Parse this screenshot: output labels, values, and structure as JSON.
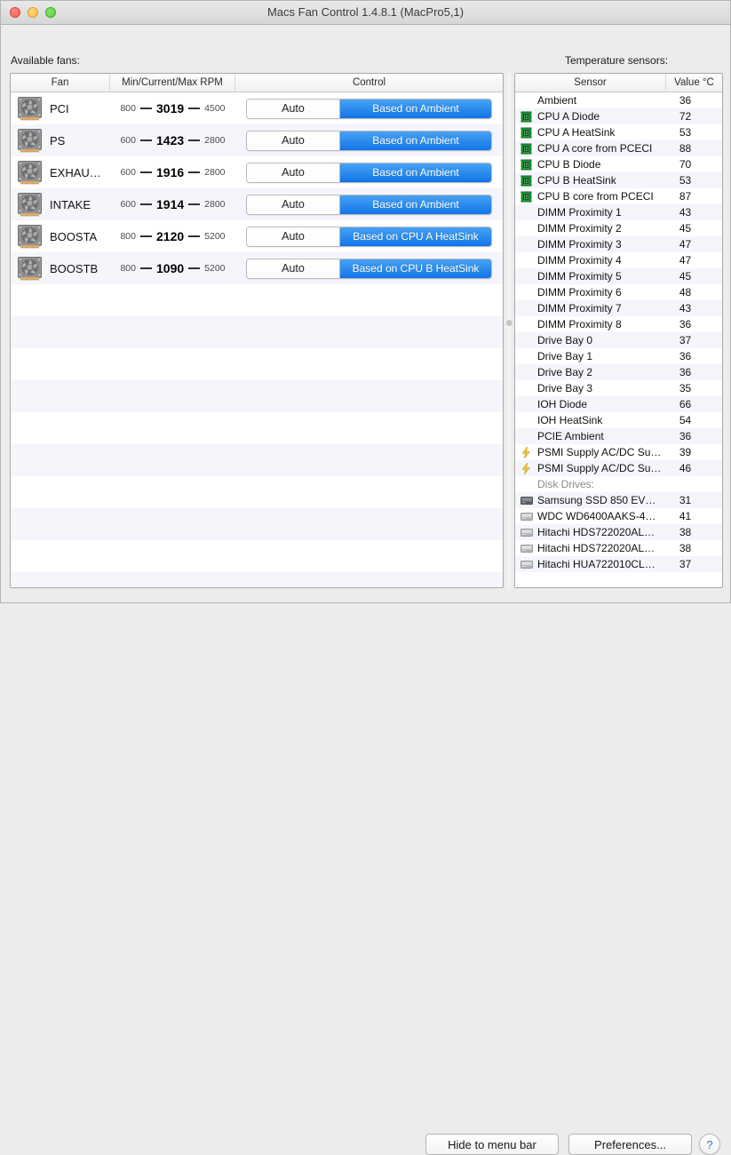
{
  "window": {
    "title": "Macs Fan Control 1.4.8.1 (MacPro5,1)",
    "traffic_lights": [
      "close-button",
      "minimize-button",
      "maximize-button"
    ],
    "accent_blue": "#1175e8",
    "alt_row_color": "#f4f6fb"
  },
  "fans_section": {
    "label": "Available fans:",
    "columns": [
      "Fan",
      "Min/Current/Max RPM",
      "Control"
    ],
    "auto_label": "Auto",
    "rows": [
      {
        "icon": "fan-icon",
        "name": "PCI",
        "min": "800",
        "current": "3019",
        "max": "4500",
        "control": "Based on Ambient"
      },
      {
        "icon": "fan-icon",
        "name": "PS",
        "min": "600",
        "current": "1423",
        "max": "2800",
        "control": "Based on Ambient"
      },
      {
        "icon": "fan-icon",
        "name": "EXHAU…",
        "min": "600",
        "current": "1916",
        "max": "2800",
        "control": "Based on Ambient"
      },
      {
        "icon": "fan-icon",
        "name": "INTAKE",
        "min": "600",
        "current": "1914",
        "max": "2800",
        "control": "Based on Ambient"
      },
      {
        "icon": "fan-icon",
        "name": "BOOSTA",
        "min": "800",
        "current": "2120",
        "max": "5200",
        "control": "Based on CPU A HeatSink"
      },
      {
        "icon": "fan-icon",
        "name": "BOOSTB",
        "min": "800",
        "current": "1090",
        "max": "5200",
        "control": "Based on CPU B HeatSink"
      }
    ]
  },
  "sensors_section": {
    "label": "Temperature sensors:",
    "columns": [
      "Sensor",
      "Value °C"
    ],
    "rows": [
      {
        "icon": "",
        "name": "Ambient",
        "value": "36"
      },
      {
        "icon": "chip-icon",
        "name": "CPU A Diode",
        "value": "72"
      },
      {
        "icon": "chip-icon",
        "name": "CPU A HeatSink",
        "value": "53"
      },
      {
        "icon": "chip-icon",
        "name": "CPU A core from PCECI",
        "value": "88"
      },
      {
        "icon": "chip-icon",
        "name": "CPU B Diode",
        "value": "70"
      },
      {
        "icon": "chip-icon",
        "name": "CPU B HeatSink",
        "value": "53"
      },
      {
        "icon": "chip-icon",
        "name": "CPU B core from PCECI",
        "value": "87"
      },
      {
        "icon": "",
        "name": "DIMM Proximity 1",
        "value": "43"
      },
      {
        "icon": "",
        "name": "DIMM Proximity 2",
        "value": "45"
      },
      {
        "icon": "",
        "name": "DIMM Proximity 3",
        "value": "47"
      },
      {
        "icon": "",
        "name": "DIMM Proximity 4",
        "value": "47"
      },
      {
        "icon": "",
        "name": "DIMM Proximity 5",
        "value": "45"
      },
      {
        "icon": "",
        "name": "DIMM Proximity 6",
        "value": "48"
      },
      {
        "icon": "",
        "name": "DIMM Proximity 7",
        "value": "43"
      },
      {
        "icon": "",
        "name": "DIMM Proximity 8",
        "value": "36"
      },
      {
        "icon": "",
        "name": "Drive Bay 0",
        "value": "37"
      },
      {
        "icon": "",
        "name": "Drive Bay 1",
        "value": "36"
      },
      {
        "icon": "",
        "name": "Drive Bay 2",
        "value": "36"
      },
      {
        "icon": "",
        "name": "Drive Bay 3",
        "value": "35"
      },
      {
        "icon": "",
        "name": "IOH Diode",
        "value": "66"
      },
      {
        "icon": "",
        "name": "IOH HeatSink",
        "value": "54"
      },
      {
        "icon": "",
        "name": "PCIE Ambient",
        "value": "36"
      },
      {
        "icon": "bolt-icon",
        "name": "PSMI Supply AC/DC Su…",
        "value": "39"
      },
      {
        "icon": "bolt-icon",
        "name": "PSMI Supply AC/DC Su…",
        "value": "46"
      },
      {
        "icon": "",
        "name": "Disk Drives:",
        "value": "",
        "group": true
      },
      {
        "icon": "ssd-icon",
        "name": "Samsung SSD 850 EV…",
        "value": "31"
      },
      {
        "icon": "hdd-icon",
        "name": "WDC WD6400AAKS-4…",
        "value": "41"
      },
      {
        "icon": "hdd-icon",
        "name": "Hitachi HDS722020AL…",
        "value": "38"
      },
      {
        "icon": "hdd-icon",
        "name": "Hitachi HDS722020AL…",
        "value": "38"
      },
      {
        "icon": "hdd-icon",
        "name": "Hitachi HUA722010CL…",
        "value": "37"
      }
    ]
  },
  "footer": {
    "hide_label": "Hide to menu bar",
    "prefs_label": "Preferences...",
    "help_label": "?"
  }
}
